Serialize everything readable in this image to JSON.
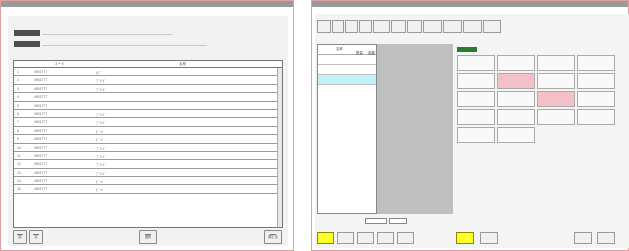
{
  "left_window": {
    "title": "",
    "field1": "",
    "field2": "",
    "table": {
      "headers": [
        "コード",
        "名称"
      ],
      "rows": [
        {
          "no": "1",
          "code": "4901777",
          "name": "ｶﾌﾞ"
        },
        {
          "no": "2",
          "code": "4901777",
          "name": "ﾌﾞﾗﾝﾄﾞ"
        },
        {
          "no": "3",
          "code": "4901777",
          "name": "ﾌﾞﾗﾝﾄﾞ"
        },
        {
          "no": "4",
          "code": "4901777",
          "name": ""
        },
        {
          "no": "5",
          "code": "4901777",
          "name": ""
        },
        {
          "no": "6",
          "code": "4901777",
          "name": "ﾌﾞﾗﾝﾄﾞ"
        },
        {
          "no": "7",
          "code": "4901777",
          "name": "ﾌﾞﾗﾝﾄﾞ"
        },
        {
          "no": "8",
          "code": "4901777",
          "name": "ﾋﾞｰﾙ"
        },
        {
          "no": "9",
          "code": "4901777",
          "name": "ﾋﾞｰﾙ"
        },
        {
          "no": "10",
          "code": "4901777",
          "name": "ﾌﾞﾗﾝﾄﾞ"
        },
        {
          "no": "11",
          "code": "4901777",
          "name": "ﾌﾞﾗﾝﾄﾞ"
        },
        {
          "no": "12",
          "code": "4901777",
          "name": "ﾌﾞﾗﾝﾄﾞ"
        },
        {
          "no": "13",
          "code": "4901777",
          "name": "ﾌﾞﾗﾝﾄﾞ"
        },
        {
          "no": "14",
          "code": "4901777",
          "name": "ﾋﾞｰﾙ"
        },
        {
          "no": "15",
          "code": "4901777",
          "name": "ﾋﾞｰﾙ"
        }
      ]
    },
    "buttons": {
      "b1": "前",
      "b2": "次",
      "b3": "選択",
      "b4": "閉じる"
    }
  },
  "right_window": {
    "title": "",
    "toolbar_buttons": [
      "",
      "",
      "",
      "",
      "",
      "",
      "",
      "",
      "",
      "",
      ""
    ],
    "list": {
      "headers": [
        "名称",
        "数量",
        "金額"
      ],
      "rows": [
        {
          "name": "",
          "qty": "",
          "amount": ""
        },
        {
          "name": "",
          "qty": "",
          "amount": ""
        },
        {
          "name": "",
          "qty": "",
          "amount": ""
        }
      ]
    },
    "tab_label": "",
    "red_notice": "",
    "grid_cells": [
      {
        "a": "",
        "b": "",
        "pink": false
      },
      {
        "a": "",
        "b": "",
        "pink": false
      },
      {
        "a": "",
        "b": "",
        "pink": false
      },
      {
        "a": "",
        "b": "",
        "pink": false
      },
      {
        "a": "",
        "b": "",
        "pink": false
      },
      {
        "a": "",
        "b": "",
        "pink": true
      },
      {
        "a": "",
        "b": "",
        "pink": false
      },
      {
        "a": "",
        "b": "",
        "pink": false
      },
      {
        "a": "",
        "b": "",
        "pink": false
      },
      {
        "a": "",
        "b": "",
        "pink": false
      },
      {
        "a": "",
        "b": "",
        "pink": true
      },
      {
        "a": "",
        "b": "",
        "pink": false
      },
      {
        "a": "",
        "b": "",
        "pink": false
      },
      {
        "a": "",
        "b": "",
        "pink": false
      },
      {
        "a": "",
        "b": "",
        "pink": false
      },
      {
        "a": "",
        "b": "",
        "pink": false
      },
      {
        "a": "",
        "b": "",
        "pink": false
      },
      {
        "a": "",
        "b": "",
        "pink": false
      }
    ],
    "bottom_left_label": "",
    "bottom_buttons": [
      "",
      "",
      "",
      "",
      ""
    ],
    "bottom_right_label": "",
    "bottom_right_buttons": [
      "",
      "",
      "",
      ""
    ]
  }
}
